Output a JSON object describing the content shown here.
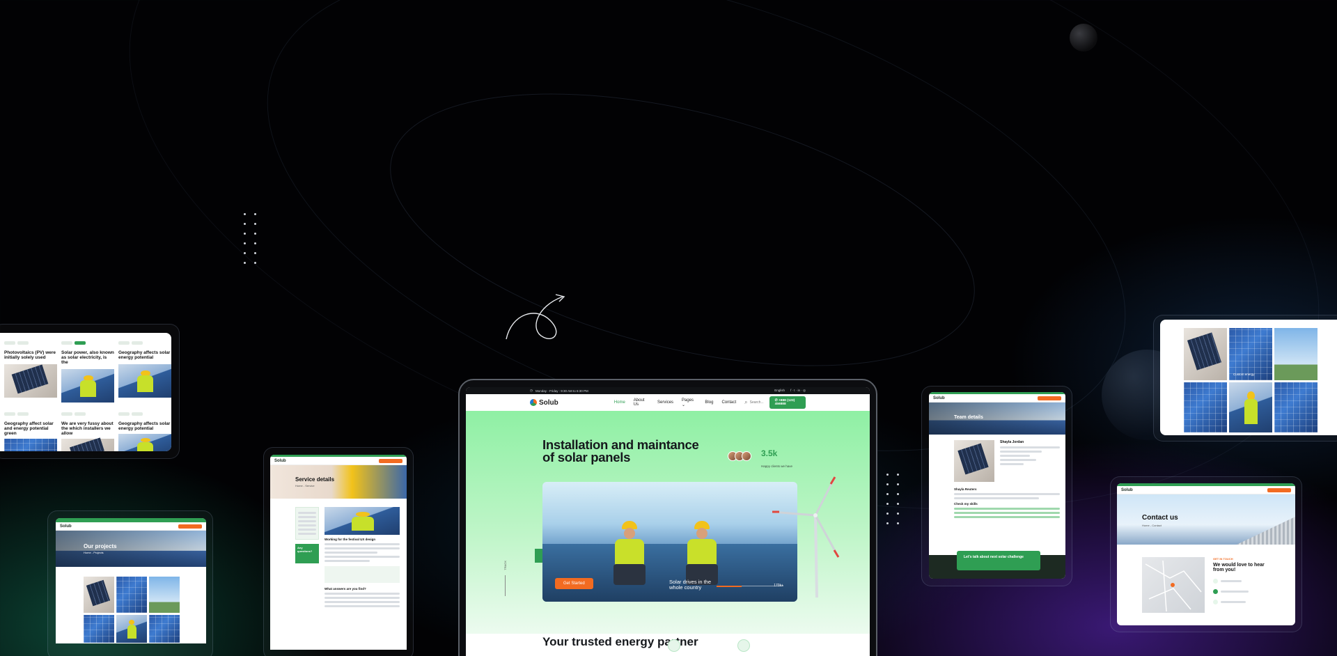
{
  "colors": {
    "brand_green": "#2f9e53",
    "accent_orange": "#f26b21",
    "hero_green": "#8ff0a4"
  },
  "main": {
    "topbar": {
      "hours": "Monday - Friday : 9:30 AM to 6:30 PM",
      "language": "English"
    },
    "nav": {
      "logo": "Solub",
      "items": [
        "Home",
        "About Us",
        "Services",
        "Pages",
        "Blog",
        "Contact"
      ],
      "search_placeholder": "Search...",
      "call": "+888 (123) 456888"
    },
    "hero": {
      "title": "Installation and maintance of solar panels",
      "stat_value": "3.5k",
      "stat_label": "Happy clients we have",
      "cta": "Get Started",
      "caption": "Solar drives in the whole country",
      "progress_value": "170k+",
      "progress_fraction": 0.38,
      "scroll_label": "TRACK"
    },
    "section_title": "Your trusted energy partner"
  },
  "blog_preview": {
    "posts": [
      "Photovoltaics (PV) were initially solely used",
      "Solar power, also known as solar electricity, is the",
      "Geography affects solar energy potential",
      "Geography affect solar and energy potential green",
      "We are very fussy about the which installers we allow",
      "Geography affects solar energy potential"
    ]
  },
  "projects_preview": {
    "logo": "Solub",
    "title": "Our projects",
    "breadcrumb": "Home - Projects"
  },
  "service_preview": {
    "logo": "Solub",
    "title": "Service details",
    "breadcrumb": "Home - Service",
    "heading": "Working for the festival UX design",
    "sidebar_cta": "Any questions?",
    "faq_title": "What answers are you find?"
  },
  "team_preview": {
    "logo": "Solub",
    "title": "Team details",
    "member_name": "Shayla Jordan",
    "bio_heading": "Shayla Reuters",
    "skills_heading": "Check my skills",
    "cta": "Let's talk about next solar challenge"
  },
  "gallery_preview": {
    "caption": "Custom energy"
  },
  "contact_preview": {
    "logo": "Solub",
    "title": "Contact us",
    "breadcrumb": "Home - Contact",
    "eyebrow": "GET IN TOUCH",
    "heading": "We would love to hear from you!"
  }
}
